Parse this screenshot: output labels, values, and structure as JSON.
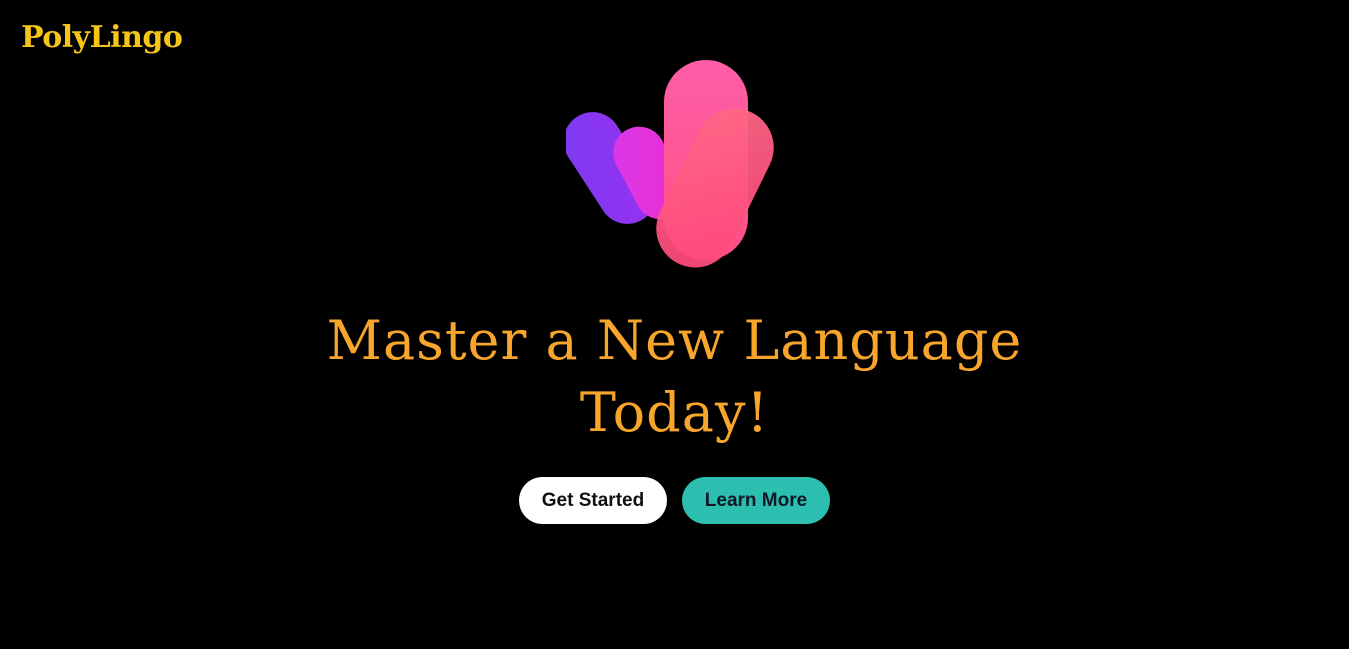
{
  "app": {
    "brand": "PolyLingo"
  },
  "hero": {
    "title_line1": "Master a New Language",
    "title_line2": "Today!",
    "art_icon": "abstract-gradient-blob-logo-icon"
  },
  "actions": {
    "primary_label": "Get Started",
    "secondary_label": "Learn More"
  },
  "colors": {
    "background": "#000000",
    "brand": "#f5c518",
    "title": "#f7a62b",
    "primary_button": "#ffffff",
    "secondary_button": "#2cbfb0",
    "blob_purple": "#8b2cf5",
    "blob_magenta": "#e82fd6",
    "blob_pink": "#ff4f8b"
  }
}
